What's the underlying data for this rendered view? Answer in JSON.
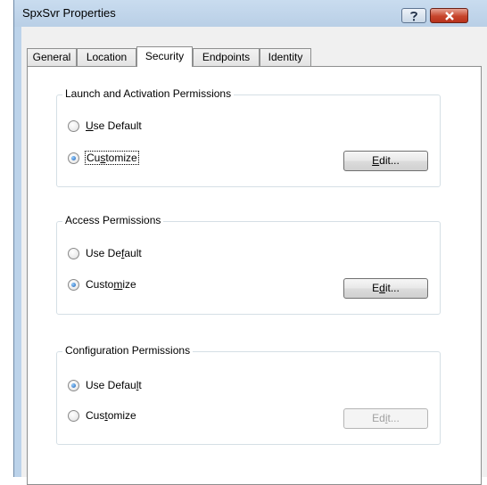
{
  "window": {
    "title": "SpxSvr Properties"
  },
  "tabs": [
    {
      "label": "General",
      "active": false
    },
    {
      "label": "Location",
      "active": false
    },
    {
      "label": "Security",
      "active": true
    },
    {
      "label": "Endpoints",
      "active": false
    },
    {
      "label": "Identity",
      "active": false
    }
  ],
  "groups": [
    {
      "title": "Launch and Activation Permissions",
      "option1": {
        "pre": "",
        "key": "U",
        "post": "se Default",
        "checked": false
      },
      "option2": {
        "pre": "Cu",
        "key": "s",
        "post": "tomize",
        "checked": true
      },
      "edit": {
        "pre": "",
        "key": "E",
        "post": "dit...",
        "enabled": true
      }
    },
    {
      "title": "Access Permissions",
      "option1": {
        "pre": "Use De",
        "key": "f",
        "post": "ault",
        "checked": false
      },
      "option2": {
        "pre": "Custo",
        "key": "m",
        "post": "ize",
        "checked": true
      },
      "edit": {
        "pre": "E",
        "key": "d",
        "post": "it...",
        "enabled": true
      }
    },
    {
      "title": "Configuration Permissions",
      "option1": {
        "pre": "Use Defau",
        "key": "l",
        "post": "t",
        "checked": true
      },
      "option2": {
        "pre": "Cus",
        "key": "t",
        "post": "omize",
        "checked": false
      },
      "edit": {
        "pre": "Ed",
        "key": "i",
        "post": "t...",
        "enabled": false
      }
    }
  ],
  "icons": {
    "help": "help-icon",
    "close": "close-icon"
  }
}
